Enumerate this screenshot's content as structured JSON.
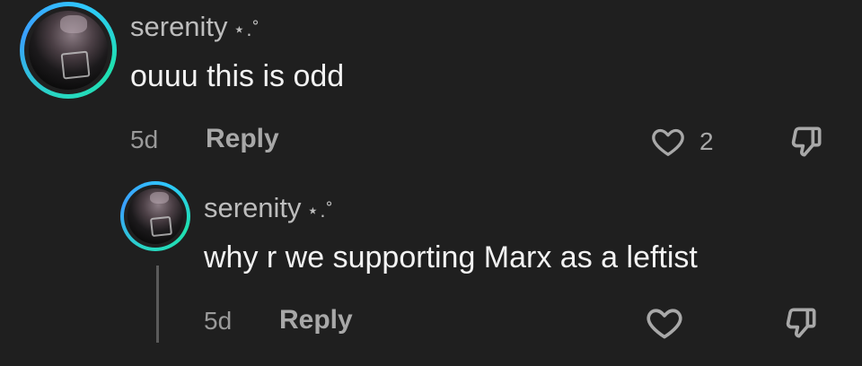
{
  "comments": [
    {
      "username": "serenity",
      "username_decoration": "⋆.˚",
      "text": "ouuu this is odd",
      "time": "5d",
      "reply_label": "Reply",
      "like_count": "2",
      "like_icon": "heart-outline-icon",
      "dislike_icon": "thumbs-down-icon"
    },
    {
      "username": "serenity",
      "username_decoration": "⋆.˚",
      "text": "why r we supporting Marx as a leftist",
      "time": "5d",
      "reply_label": "Reply",
      "like_icon": "heart-outline-icon",
      "dislike_icon": "thumbs-down-icon"
    }
  ],
  "colors": {
    "background": "#1f1f1f",
    "avatar_ring_start": "#29d6c4",
    "avatar_ring_end": "#3aa0ff"
  }
}
